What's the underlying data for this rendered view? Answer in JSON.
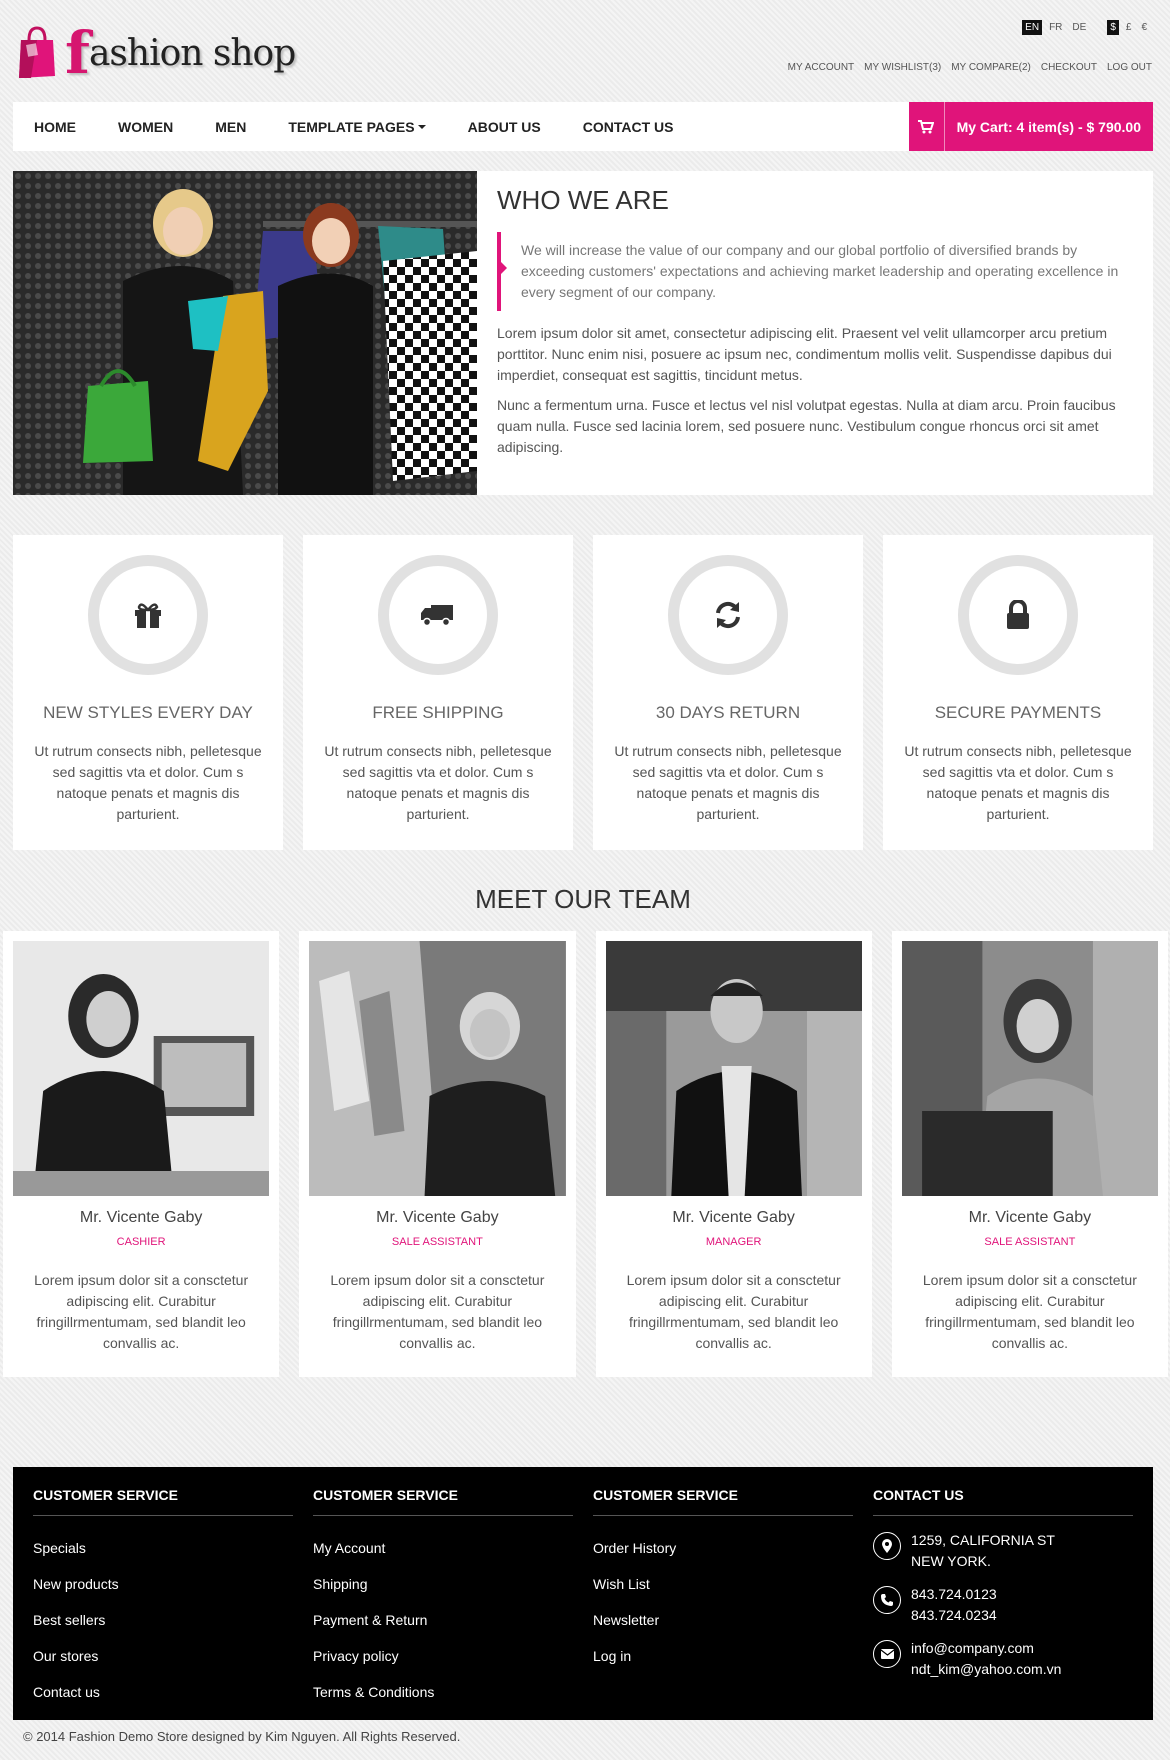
{
  "header": {
    "logo_f": "f",
    "logo_rest": "ashion shop",
    "languages": [
      "EN",
      "FR",
      "DE"
    ],
    "currencies": [
      "$",
      "£",
      "€"
    ],
    "top_links": [
      "MY ACCOUNT",
      "MY WISHLIST(3)",
      "MY COMPARE(2)",
      "CHECKOUT",
      "LOG OUT"
    ]
  },
  "nav": {
    "items": [
      "HOME",
      "WOMEN",
      "MEN",
      "TEMPLATE PAGES",
      "ABOUT US",
      "CONTACT US"
    ],
    "cart_label": "My Cart: 4 item(s) - $ 790.00"
  },
  "who": {
    "title": "WHO WE ARE",
    "quote": "We will increase the value of our company and our global portfolio of diversified brands by exceeding customers' expectations and achieving market leadership and operating excellence in every segment of our company.",
    "p1": "Lorem ipsum dolor sit amet, consectetur adipiscing elit. Praesent vel velit ullamcorper arcu pretium porttitor. Nunc enim nisi, posuere ac ipsum nec, condimentum mollis velit. Suspendisse dapibus dui imperdiet, consequat est sagittis, tincidunt metus.",
    "p2": "Nunc a fermentum urna. Fusce et lectus vel nisl volutpat egestas. Nulla at diam arcu. Proin faucibus quam nulla. Fusce sed lacinia lorem, sed posuere nunc. Vestibulum congue rhoncus orci sit amet adipiscing."
  },
  "features": [
    {
      "icon": "gift-icon",
      "title": "NEW STYLES EVERY DAY",
      "desc": "Ut rutrum consects nibh, pelletesque sed sagittis vta et dolor. Cum s natoque penats et magnis dis parturient."
    },
    {
      "icon": "truck-icon",
      "title": "FREE SHIPPING",
      "desc": "Ut rutrum consects nibh, pelletesque sed sagittis vta et dolor. Cum s natoque penats et magnis dis parturient."
    },
    {
      "icon": "refresh-icon",
      "title": "30 DAYS RETURN",
      "desc": "Ut rutrum consects nibh, pelletesque sed sagittis vta et dolor. Cum s natoque penats et magnis dis parturient."
    },
    {
      "icon": "lock-icon",
      "title": "SECURE PAYMENTS",
      "desc": "Ut rutrum consects nibh, pelletesque sed sagittis vta et dolor. Cum s natoque penats et magnis dis parturient."
    }
  ],
  "team": {
    "title": "MEET OUR TEAM",
    "members": [
      {
        "name": "Mr. Vicente Gaby",
        "role": "CASHIER",
        "desc": "Lorem ipsum dolor sit a consctetur adipiscing elit. Curabitur fringillrmentumam, sed blandit leo convallis ac."
      },
      {
        "name": "Mr. Vicente Gaby",
        "role": "SALE ASSISTANT",
        "desc": "Lorem ipsum dolor sit a consctetur adipiscing elit. Curabitur fringillrmentumam, sed blandit leo convallis ac."
      },
      {
        "name": "Mr. Vicente Gaby",
        "role": "MANAGER",
        "desc": "Lorem ipsum dolor sit a consctetur adipiscing elit. Curabitur fringillrmentumam, sed blandit leo convallis ac."
      },
      {
        "name": "Mr. Vicente Gaby",
        "role": "SALE ASSISTANT",
        "desc": "Lorem ipsum dolor sit a consctetur adipiscing elit. Curabitur fringillrmentumam, sed blandit leo convallis ac."
      }
    ]
  },
  "footer": {
    "col1": {
      "title": "CUSTOMER SERVICE",
      "links": [
        "Specials",
        "New products",
        "Best sellers",
        "Our stores",
        "Contact us"
      ]
    },
    "col2": {
      "title": "CUSTOMER SERVICE",
      "links": [
        "My Account",
        "Shipping",
        "Payment & Return",
        "Privacy policy",
        "Terms & Conditions"
      ]
    },
    "col3": {
      "title": "CUSTOMER SERVICE",
      "links": [
        "Order History",
        "Wish List",
        "Newsletter",
        "Log in"
      ]
    },
    "contact": {
      "title": "CONTACT US",
      "address": [
        "1259, CALIFORNIA ST",
        "NEW YORK."
      ],
      "phones": [
        "843.724.0123",
        "843.724.0234"
      ],
      "emails": [
        "info@company.com",
        "ndt_kim@yahoo.com.vn"
      ]
    },
    "copyright": "© 2014 Fashion Demo Store designed by Kim Nguyen. All Rights Reserved."
  },
  "colors": {
    "accent": "#e0147a",
    "footer_bg": "#000000"
  }
}
